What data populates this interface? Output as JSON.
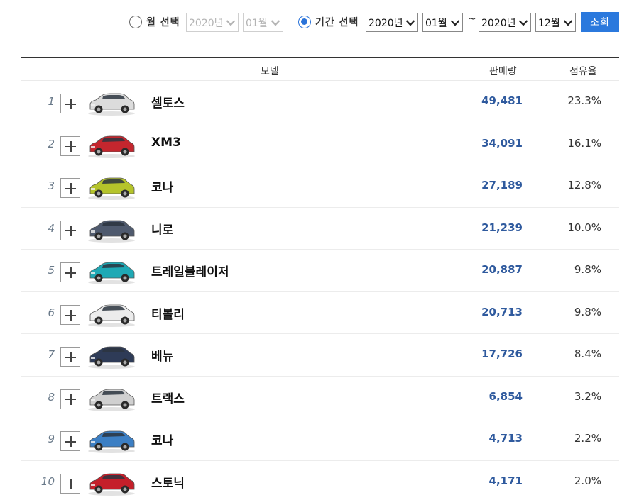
{
  "filters": {
    "month_select": {
      "label": "월 선택",
      "checked": false,
      "year": "2020년",
      "month": "01월"
    },
    "period_select": {
      "label": "기간 선택",
      "checked": true,
      "from_year": "2020년",
      "from_month": "01월",
      "separator": "~",
      "to_year": "2020년",
      "to_month": "12월"
    },
    "query_button": "조회"
  },
  "table": {
    "headers": {
      "model": "모델",
      "sales": "판매량",
      "share": "점유율"
    },
    "rows": [
      {
        "rank": "1",
        "model": "셀토스",
        "sales": "49,481",
        "share": "23.3%",
        "car_color": "#dcdcdc",
        "car_icon": "suv-white-icon"
      },
      {
        "rank": "2",
        "model": "XM3",
        "sales": "34,091",
        "share": "16.1%",
        "car_color": "#c4262e",
        "car_icon": "suv-red-icon"
      },
      {
        "rank": "3",
        "model": "코나",
        "sales": "27,189",
        "share": "12.8%",
        "car_color": "#b5c42a",
        "car_icon": "suv-lime-icon"
      },
      {
        "rank": "4",
        "model": "니로",
        "sales": "21,239",
        "share": "10.0%",
        "car_color": "#4f5a6e",
        "car_icon": "suv-gray-icon"
      },
      {
        "rank": "5",
        "model": "트레일블레이저",
        "sales": "20,887",
        "share": "9.8%",
        "car_color": "#1fa9b5",
        "car_icon": "suv-teal-icon"
      },
      {
        "rank": "6",
        "model": "티볼리",
        "sales": "20,713",
        "share": "9.8%",
        "car_color": "#ececec",
        "car_icon": "suv-white-icon"
      },
      {
        "rank": "7",
        "model": "베뉴",
        "sales": "17,726",
        "share": "8.4%",
        "car_color": "#2e3b57",
        "car_icon": "suv-navy-icon"
      },
      {
        "rank": "8",
        "model": "트랙스",
        "sales": "6,854",
        "share": "3.2%",
        "car_color": "#d0d0d0",
        "car_icon": "suv-silver-icon"
      },
      {
        "rank": "9",
        "model": "코나",
        "sales": "4,713",
        "share": "2.2%",
        "car_color": "#3c7fc4",
        "car_icon": "suv-blue-icon"
      },
      {
        "rank": "10",
        "model": "스토닉",
        "sales": "4,171",
        "share": "2.0%",
        "car_color": "#c51f2a",
        "car_icon": "suv-red-icon"
      }
    ]
  },
  "colors": {
    "accent": "#2b79dd",
    "sales_text": "#2f5a9e"
  }
}
